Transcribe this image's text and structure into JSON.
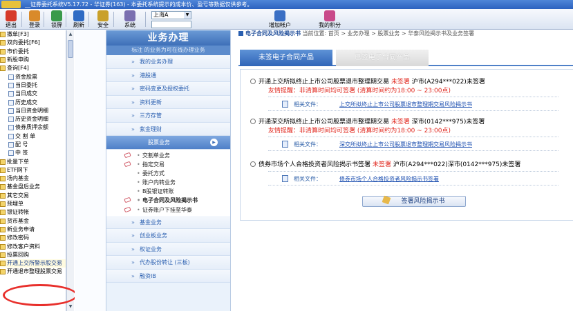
{
  "window": {
    "title": "  __证券委托系统V5.17.72 - 华证券(163) - 本委托系统提示的成本价、盈亏等数据仅供参考。"
  },
  "toolbar": {
    "buttons": [
      {
        "label": "退出",
        "icon": "power-icon",
        "color": "#d63a2a"
      },
      {
        "label": "登录",
        "icon": "users-icon",
        "color": "#d98a2a"
      },
      {
        "label": "锁屏",
        "icon": "lock-icon",
        "color": "#3a9a4a"
      },
      {
        "label": "刷新",
        "icon": "refresh-icon",
        "color": "#2f6bc4"
      },
      {
        "label": "安全",
        "icon": "shield-icon",
        "color": "#c9a02a"
      },
      {
        "label": "系统",
        "icon": "tools-icon",
        "color": "#7a6fb0"
      },
      {
        "label": "增加帐户",
        "icon": "add-user-icon",
        "color": "#3a6fc4"
      },
      {
        "label": "我的积分",
        "icon": "points-icon",
        "color": "#c94a8a"
      }
    ],
    "market_select": "上海A"
  },
  "tree": {
    "items": [
      {
        "label": "撤单[F3]",
        "level": 0
      },
      {
        "label": "双向委托[F6]",
        "level": 0
      },
      {
        "label": "市价委托",
        "level": 0
      },
      {
        "label": "新股申购",
        "level": 0
      },
      {
        "label": "查询[F4]",
        "level": 0
      },
      {
        "label": "资金股票",
        "level": 1
      },
      {
        "label": "当日委托",
        "level": 1
      },
      {
        "label": "当日成交",
        "level": 1
      },
      {
        "label": "历史成交",
        "level": 1
      },
      {
        "label": "当日资金明细",
        "level": 1
      },
      {
        "label": "历史资金明细",
        "level": 1
      },
      {
        "label": "债券质押余额",
        "level": 1
      },
      {
        "label": "交 割 单",
        "level": 1
      },
      {
        "label": "配    号",
        "level": 1
      },
      {
        "label": "中    签",
        "level": 1
      },
      {
        "label": "批量下单",
        "level": 0
      },
      {
        "label": "ETF网下",
        "level": 0
      },
      {
        "label": "场内基金",
        "level": 0
      },
      {
        "label": "基金盘后业务",
        "level": 0
      },
      {
        "label": "其它交易",
        "level": 0
      },
      {
        "label": "预埋单",
        "level": 0
      },
      {
        "label": "银证转帐",
        "level": 0
      },
      {
        "label": "货币基金",
        "level": 0
      },
      {
        "label": "新业务申请",
        "level": 0
      },
      {
        "label": "修改密码",
        "level": 0
      },
      {
        "label": "修改客户资料",
        "level": 0
      },
      {
        "label": "投票回购",
        "level": 0
      },
      {
        "label": "开通上交所警示股交易",
        "level": 0,
        "highlight": true
      },
      {
        "label": "开通退市整理股票交易",
        "level": 0
      }
    ]
  },
  "business": {
    "title": "业务办理",
    "note": "标注  的业务为可在线办理业务",
    "items_top": [
      "我的业务办理",
      "港股通",
      "密码变更及授权委托",
      "资料更新",
      "三方存管",
      "紫金理财"
    ],
    "active": "股票业务",
    "sub_items": [
      {
        "label": "交割单业务",
        "tag": true
      },
      {
        "label": "指定交易",
        "tag": true
      },
      {
        "label": "委托方式",
        "tag": false
      },
      {
        "label": "账户内转业务",
        "tag": false
      },
      {
        "label": "B股银证转账",
        "tag": false
      },
      {
        "label": "电子合同及风险揭示书",
        "tag": true,
        "bold": true
      },
      {
        "label": "证券账户下挂至华泰",
        "tag": true
      }
    ],
    "items_bottom": [
      "基金业务",
      "创业板业务",
      "权证业务",
      "代办股份转让 (三板)",
      "融资IB"
    ]
  },
  "content": {
    "breadcrumb_prefix": "电子合同及风险揭示书",
    "breadcrumb_rest": "当前位置: 首页 > 业务办理 > 股票业务 > 华泰风险揭示书及业务签署",
    "tab_active": "未签电子合同产品",
    "tab_inactive": "已签电子合同产品",
    "options": [
      {
        "text": "开通上交所拟终止上市公司股票退市整理期交易",
        "status": "未签署",
        "account": "沪市(A294***022)未签署",
        "warn": "友情提醒：非清算时间均可签署 (清算时间约为18:00 ~ 23:00点)",
        "file_label": "相关文件：",
        "file_link": "上交所拟终止上市公司股票退市整理期交易风险揭示书"
      },
      {
        "text": "开通深交所拟终止上市公司股票退市整理期交易",
        "status": "未签署",
        "account": "深市(0142***975)未签署",
        "warn": "友情提醒：非清算时间均可签署 (清算时间约为18:00 ~ 23:00点)",
        "file_label": "相关文件：",
        "file_link": "深交所拟终止上市公司股票退市整理期交易风险揭示书"
      },
      {
        "text": "债券市场个人合格投资者风险揭示书签署",
        "status": "未签署",
        "account": "沪市(A294***022)深市(0142***975)未签署",
        "warn": "",
        "file_label": "相关文件：",
        "file_link": "债券市场个人合格投资者风险揭示书签署"
      }
    ],
    "sign_button": "签署风险揭示书"
  }
}
